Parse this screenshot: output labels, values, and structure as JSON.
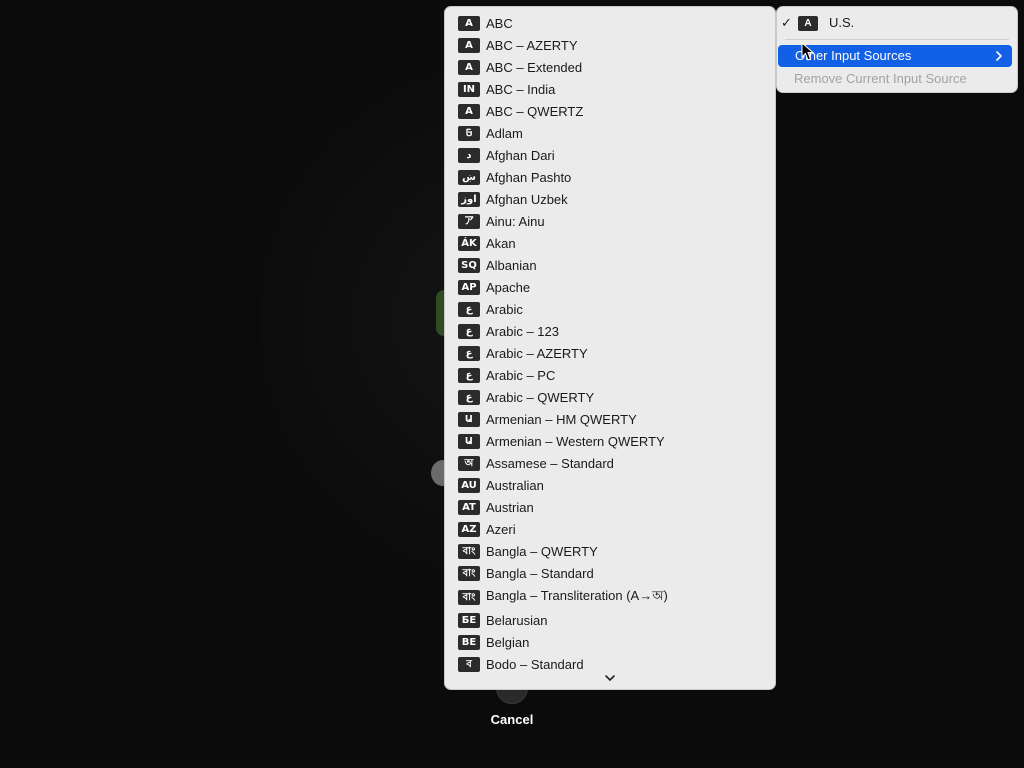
{
  "background": {
    "cancel_label": "Cancel"
  },
  "main_menu": {
    "current_source": {
      "badge": "A",
      "label": "U.S.",
      "checked": true
    },
    "other_input_sources_label": "Other Input Sources",
    "remove_label": "Remove Current Input Source"
  },
  "submenu": {
    "items": [
      {
        "badge": "A",
        "label": "ABC"
      },
      {
        "badge": "A",
        "label": "ABC – AZERTY"
      },
      {
        "badge": "A",
        "label": "ABC – Extended"
      },
      {
        "badge": "IN",
        "label": "ABC – India"
      },
      {
        "badge": "A",
        "label": "ABC – QWERTZ"
      },
      {
        "badge": "𞤀",
        "label": "Adlam"
      },
      {
        "badge": "د",
        "label": "Afghan Dari"
      },
      {
        "badge": "ښ",
        "label": "Afghan Pashto"
      },
      {
        "badge": "اوز",
        "label": "Afghan Uzbek"
      },
      {
        "badge": "ア",
        "label": "Ainu: Ainu"
      },
      {
        "badge": "ÁK",
        "label": "Akan"
      },
      {
        "badge": "SQ",
        "label": "Albanian"
      },
      {
        "badge": "AP",
        "label": "Apache"
      },
      {
        "badge": "ع",
        "label": "Arabic"
      },
      {
        "badge": "ع",
        "label": "Arabic – 123"
      },
      {
        "badge": "ع",
        "label": "Arabic – AZERTY"
      },
      {
        "badge": "ع",
        "label": "Arabic – PC"
      },
      {
        "badge": "ع",
        "label": "Arabic – QWERTY"
      },
      {
        "badge": "Ա",
        "label": "Armenian – HM QWERTY"
      },
      {
        "badge": "Ա",
        "label": "Armenian – Western QWERTY"
      },
      {
        "badge": "অ",
        "label": "Assamese – Standard"
      },
      {
        "badge": "AU",
        "label": "Australian"
      },
      {
        "badge": "AT",
        "label": "Austrian"
      },
      {
        "badge": "AZ",
        "label": "Azeri"
      },
      {
        "badge": "বাং",
        "label": "Bangla – QWERTY"
      },
      {
        "badge": "বাং",
        "label": "Bangla – Standard"
      },
      {
        "badge": "বাং",
        "label": "Bangla – Transliteration (A→অ)"
      },
      {
        "badge": "БЕ",
        "label": "Belarusian"
      },
      {
        "badge": "BE",
        "label": "Belgian"
      },
      {
        "badge": "ব",
        "label": "Bodo – Standard"
      }
    ],
    "scroll_indicator": "chevron-down-icon"
  }
}
